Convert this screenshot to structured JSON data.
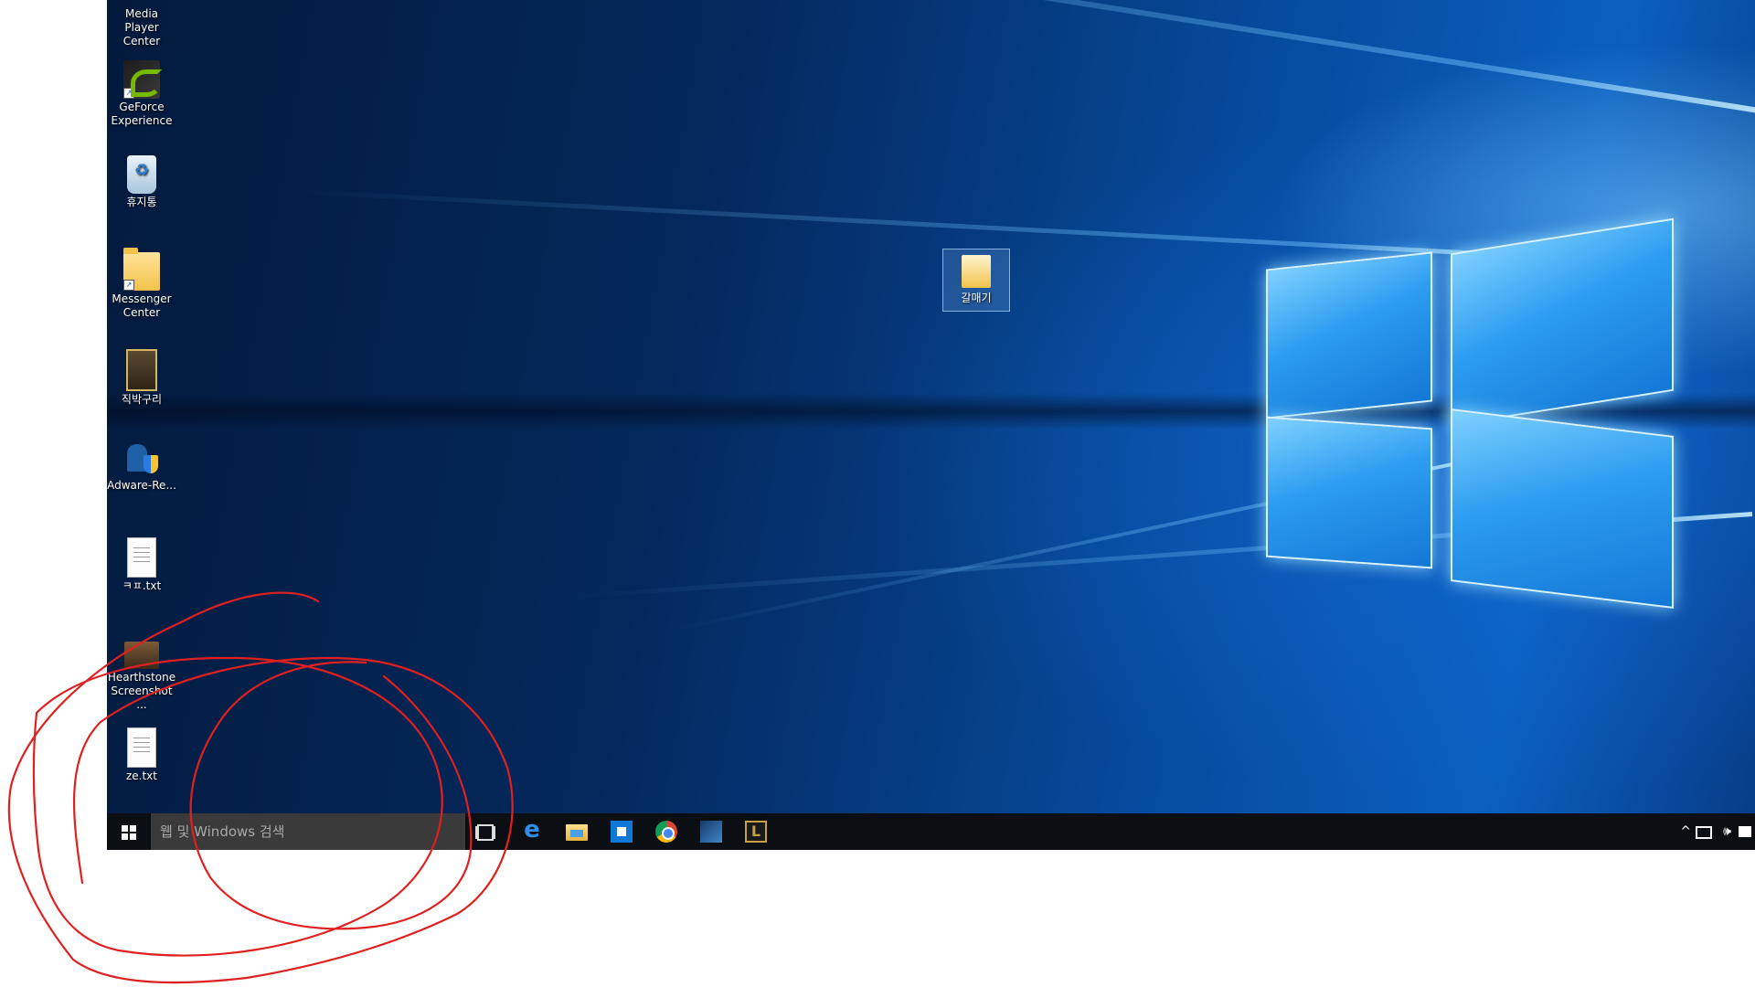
{
  "desktop": {
    "icons": [
      {
        "label": "Media Player\nCenter",
        "icon": "media-center-icon"
      },
      {
        "label": "GeForce\nExperience",
        "icon": "nvidia-icon"
      },
      {
        "label": "휴지통",
        "icon": "recycle-bin-icon"
      },
      {
        "label": "Messenger\nCenter",
        "icon": "folder-icon"
      },
      {
        "label": "직박구리",
        "icon": "photo-folder-icon"
      },
      {
        "label": "Adware-Re...",
        "icon": "adware-icon"
      },
      {
        "label": "ㅋㅍ.txt",
        "icon": "text-file-icon"
      },
      {
        "label": "Hearthstone\nScreenshot ...",
        "icon": "screenshot-icon"
      },
      {
        "label": "ze.txt",
        "icon": "text-file-icon"
      }
    ],
    "center_folder": {
      "label": "갈매기",
      "icon": "folder-icon"
    }
  },
  "taskbar": {
    "search_placeholder": "웹 및 Windows 검색",
    "pinned": [
      "task-view-icon",
      "edge-icon",
      "file-explorer-icon",
      "store-icon",
      "chrome-icon",
      "hearthstone-app-icon",
      "league-of-legends-icon"
    ],
    "lol_glyph": "L",
    "edge_glyph": "e",
    "tray": {
      "chevron": "^",
      "volume": "🕪"
    }
  },
  "annotation_color": "#e02020"
}
